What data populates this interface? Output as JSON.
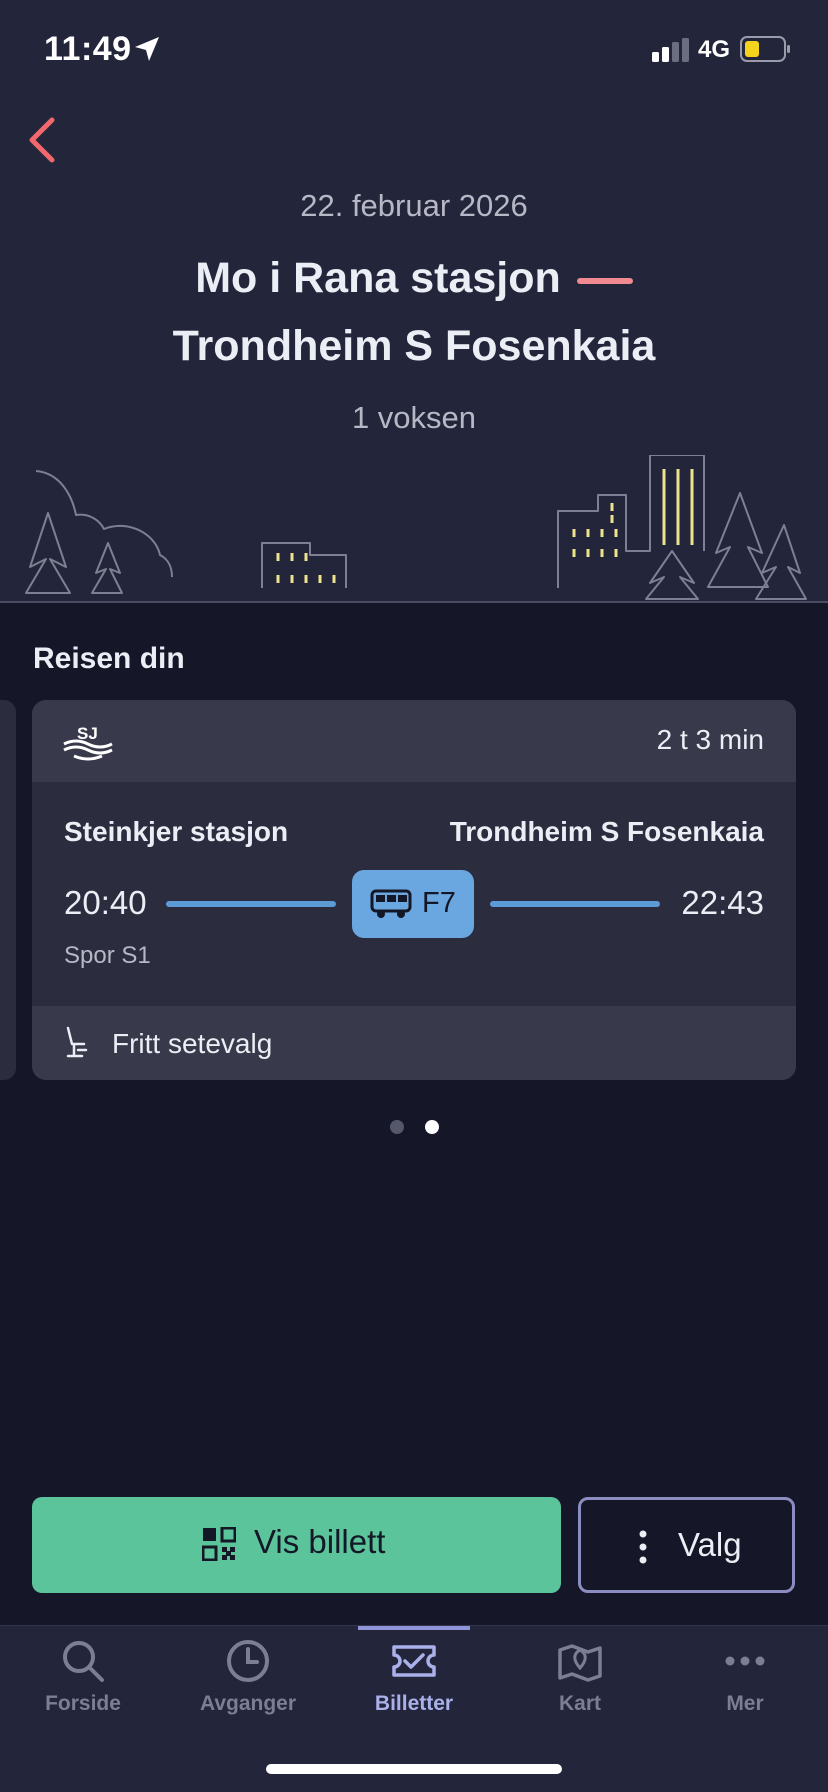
{
  "status_bar": {
    "time": "11:49",
    "network": "4G"
  },
  "header": {
    "date": "22. februar 2026",
    "from": "Mo i Rana stasjon",
    "to": "Trondheim S Fosenkaia",
    "passengers": "1 voksen"
  },
  "section_title": "Reisen din",
  "leg": {
    "operator_icon": "sj-logo",
    "duration": "2 t 3 min",
    "from_station": "Steinkjer stasjon",
    "to_station": "Trondheim S Fosenkaia",
    "departure": "20:40",
    "arrival": "22:43",
    "line_icon": "bus-icon",
    "line": "F7",
    "track": "Spor S1",
    "seat_info": "Fritt setevalg"
  },
  "pager": {
    "count": 2,
    "active_index": 1
  },
  "actions": {
    "show_ticket": "Vis billett",
    "options": "Valg"
  },
  "tabs": [
    {
      "label": "Forside",
      "icon": "search-icon",
      "active": false
    },
    {
      "label": "Avganger",
      "icon": "clock-icon",
      "active": false
    },
    {
      "label": "Billetter",
      "icon": "ticket-icon",
      "active": true
    },
    {
      "label": "Kart",
      "icon": "map-icon",
      "active": false
    },
    {
      "label": "Mer",
      "icon": "more-icon",
      "active": false
    }
  ],
  "colors": {
    "background": "#151728",
    "header": "#23253a",
    "accent_red": "#f08a8e",
    "route_blue": "#5d9bd6",
    "primary_green": "#5cc49b",
    "active_tab": "#aab0ea"
  }
}
